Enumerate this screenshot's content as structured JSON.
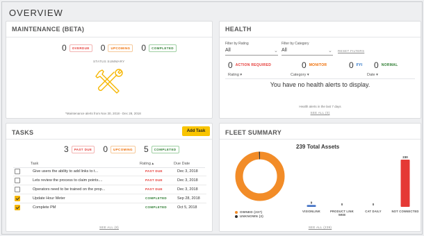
{
  "page": {
    "title": "OVERVIEW"
  },
  "maintenance": {
    "title": "MAINTENANCE (BETA)",
    "counts": [
      {
        "value": "0",
        "label": "OVERDUE"
      },
      {
        "value": "0",
        "label": "UPCOMING"
      },
      {
        "value": "0",
        "label": "COMPLETED"
      }
    ],
    "status_summary": "STATUS SUMMARY",
    "note": "*Maintenance alerts from Nov 30, 2018 - Dec 28, 2018"
  },
  "health": {
    "title": "HEALTH",
    "filter_rating": {
      "label": "Filter by Rating",
      "value": "All"
    },
    "filter_category": {
      "label": "Filter by Category",
      "value": "All"
    },
    "reset": "RESET FILTERS",
    "counts": [
      {
        "value": "0",
        "label": "ACTION REQUIRED"
      },
      {
        "value": "0",
        "label": "MONITOR"
      },
      {
        "value": "0",
        "label": "FYI"
      },
      {
        "value": "0",
        "label": "NORMAL"
      }
    ],
    "columns": {
      "rating": "Rating ▾",
      "category": "Category ▾",
      "date": "Date ▾"
    },
    "empty": "You have no health alerts to display.",
    "footer_note": "Health alerts in the last 7 days",
    "see_all": "SEE ALL (0)"
  },
  "tasks": {
    "title": "TASKS",
    "add_button": "Add Task",
    "counts": [
      {
        "value": "3",
        "label": "PAST DUE"
      },
      {
        "value": "0",
        "label": "UPCOMING"
      },
      {
        "value": "5",
        "label": "COMPLETED"
      }
    ],
    "columns": {
      "task": "Task",
      "rating": "Rating ▴",
      "due": "Due Date"
    },
    "rows": [
      {
        "task": "Give users the ability to add links to t...",
        "status": "PAST DUE",
        "due": "Dec 3, 2018",
        "checked": false
      },
      {
        "task": "Lets review the process to claim points....",
        "status": "PAST DUE",
        "due": "Dec 3, 2018",
        "checked": false
      },
      {
        "task": "Operators need to be trained on the prop...",
        "status": "PAST DUE",
        "due": "Dec 3, 2018",
        "checked": false
      },
      {
        "task": "Update Hour Meter",
        "status": "COMPLETED",
        "due": "Sep 28, 2018",
        "checked": true
      },
      {
        "task": "Complete PM",
        "status": "COMPLETED",
        "due": "Oct 5, 2018",
        "checked": true
      }
    ],
    "see_all": "SEE ALL (8)"
  },
  "fleet": {
    "title": "FLEET SUMMARY",
    "total": "239 Total Assets",
    "legend": [
      {
        "label": "OWNED (237)",
        "color": "#f28c28"
      },
      {
        "label": "UNKNOWN (2)",
        "color": "#333333"
      }
    ],
    "see_all": "SEE ALL (239)"
  },
  "colors": {
    "accent": "#f9c400",
    "orange": "#f28c28",
    "red": "#e53935",
    "blue": "#3f6fc4"
  },
  "chart_data": [
    {
      "type": "pie",
      "categories": [
        "OWNED",
        "UNKNOWN"
      ],
      "values": [
        237,
        2
      ]
    },
    {
      "type": "bar",
      "categories": [
        "VISIONLINK",
        "PRODUCT LINK WEB",
        "CAT DAILY",
        "NOT CONNECTED"
      ],
      "values": [
        9,
        0,
        0,
        230
      ],
      "colors": [
        "#3f6fc4",
        "#3f6fc4",
        "#3f6fc4",
        "#e53935"
      ],
      "ylim": [
        0,
        230
      ]
    }
  ]
}
